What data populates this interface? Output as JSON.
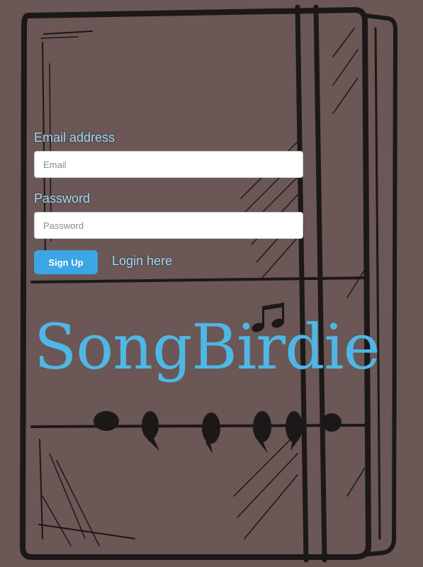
{
  "form": {
    "email_label": "Email address",
    "email_placeholder": "Email",
    "password_label": "Password",
    "password_placeholder": "Password",
    "signup_label": "Sign Up",
    "login_link": "Login here"
  },
  "brand": {
    "logo_text": "SongBirdie",
    "accent_color": "#4fb7e6"
  }
}
